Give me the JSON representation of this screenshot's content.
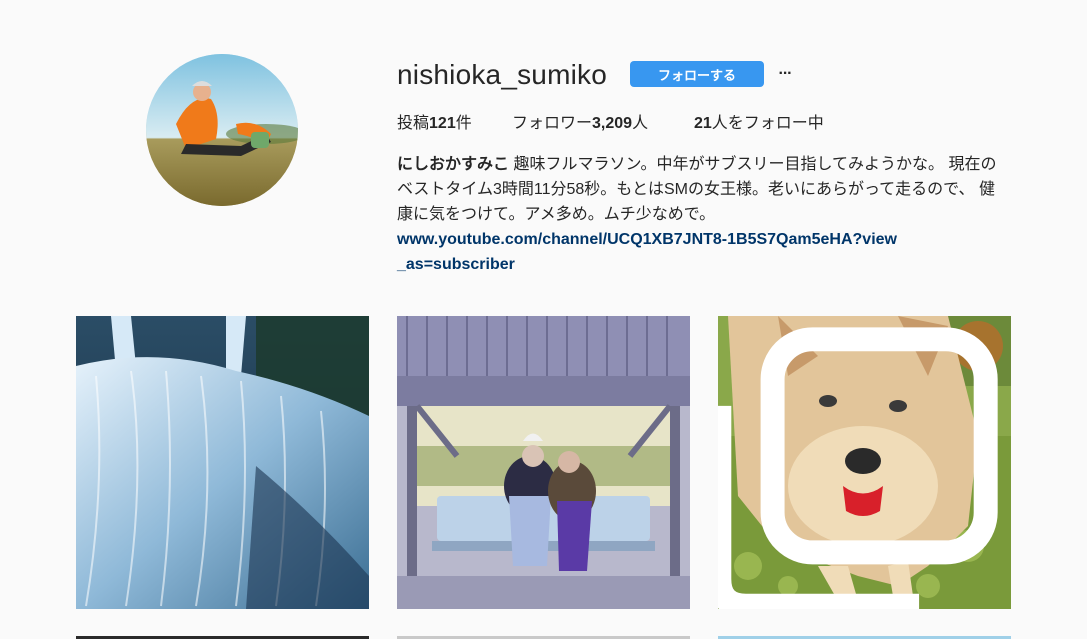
{
  "profile": {
    "username": "nishioka_sumiko",
    "follow_label": "フォローする",
    "more_label": "···",
    "stats": {
      "posts_label": "投稿",
      "posts_count": "121",
      "posts_suffix": "件",
      "followers_label": "フォロワー",
      "followers_count": "3,209",
      "followers_suffix": "人",
      "following_count": "21",
      "following_suffix": "人をフォロー中"
    },
    "bio": {
      "name": "にしおかすみこ",
      "text": " 趣味フルマラソン。中年がサブスリー目指してみようかな。 現在のベストタイム3時間11分58秒。もとはSMの女王様。老いにあらがって走るので、 健康に気をつけて。アメ多め。ムチ少なめで。",
      "link": "www.youtube.com/channel/UCQ1XB7JNT8-1B5S7Qam5eHA?view_as=subscriber"
    }
  },
  "posts": [
    {
      "subject": "waterfall"
    },
    {
      "subject": "two-women-at-bus-stop"
    },
    {
      "subject": "dog-with-tongue-out",
      "multi": true
    }
  ],
  "colors": {
    "accent": "#3897f0",
    "link": "#003569",
    "background": "#fafafa"
  }
}
